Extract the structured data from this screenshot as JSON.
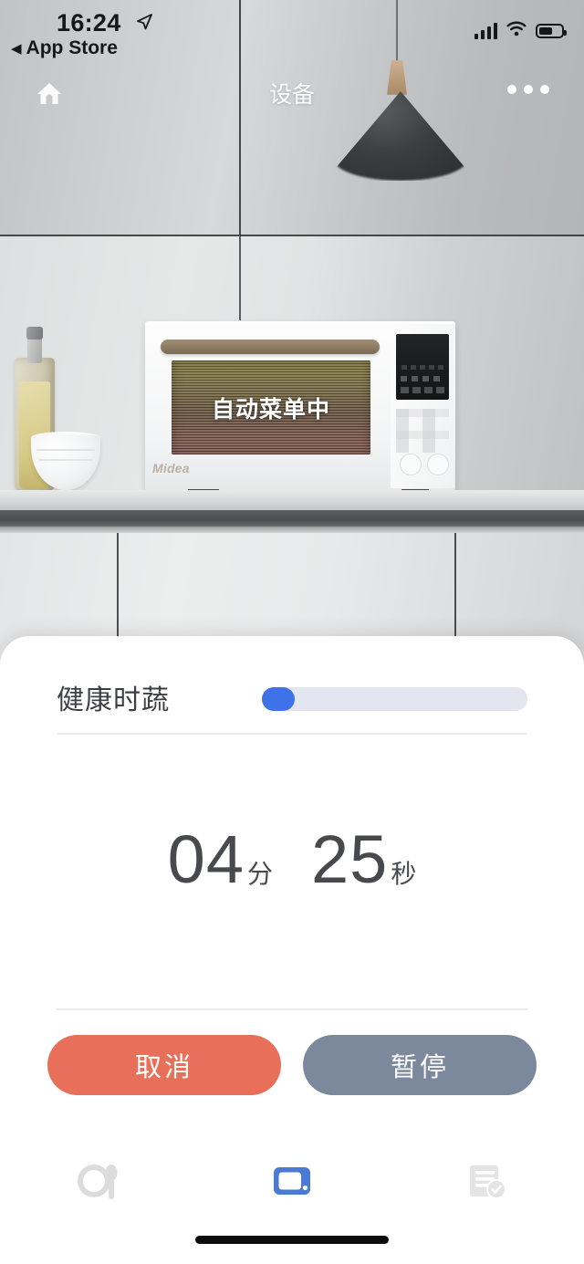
{
  "status_bar": {
    "time": "16:24",
    "back_label": "App Store",
    "back_caret": "◀",
    "location_icon": "location-arrow-icon",
    "signal_icon": "cellular-signal-icon",
    "wifi_icon": "wifi-icon",
    "battery_icon": "battery-icon",
    "battery_level_pct": 62
  },
  "nav_bar": {
    "home_icon": "home-icon",
    "title": "设备",
    "more_icon": "more-options-icon"
  },
  "device_scene": {
    "appliance_brand": "Midea",
    "appliance_status_text": "自动菜单中",
    "appliance_type": "microwave-oven"
  },
  "card": {
    "program_name": "健康时蔬",
    "progress": {
      "value_pct": 6,
      "accent_color": "#3f72e8",
      "track_color": "#e3e6f0"
    },
    "timer": {
      "minutes": "04",
      "minutes_unit": "分",
      "seconds": "25",
      "seconds_unit": "秒"
    },
    "buttons": {
      "cancel_label": "取消",
      "cancel_color": "#e8705a",
      "pause_label": "暂停",
      "pause_color": "#7c889c"
    }
  },
  "tab_bar": {
    "items": [
      {
        "name": "recipes",
        "icon": "plate-spoon-icon",
        "active": false,
        "color": "#dcdcdc"
      },
      {
        "name": "devices",
        "icon": "appliance-device-icon",
        "active": true,
        "color": "#4a7ad4"
      },
      {
        "name": "records",
        "icon": "list-check-icon",
        "active": false,
        "color": "#e2e2e2"
      }
    ]
  }
}
